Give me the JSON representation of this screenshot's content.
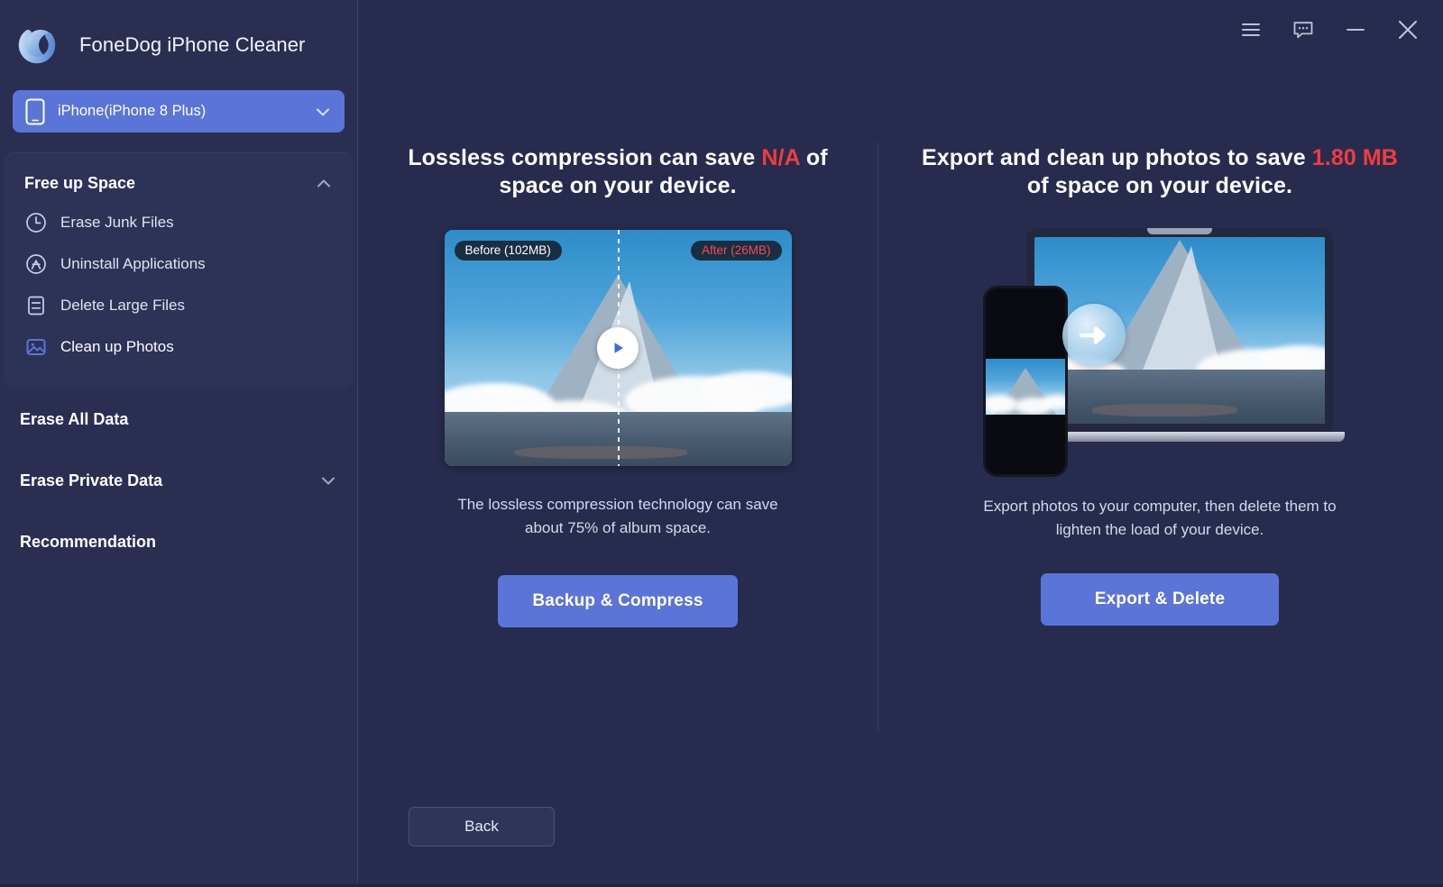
{
  "app": {
    "title": "FoneDog iPhone Cleaner",
    "logo_icon": "fonedog-c-logo-icon",
    "accent": "#5b74d8",
    "danger": "#f03c41",
    "sidebar_bg": "#2a2f52",
    "main_bg": "#272c4e"
  },
  "titlebar": {
    "menu_icon": "hamburger-menu-icon",
    "feedback_icon": "chat-bubble-icon",
    "minimize_icon": "minimize-icon",
    "close_icon": "close-icon"
  },
  "device_selector": {
    "icon": "phone-icon",
    "value": "iPhone(iPhone 8 Plus)",
    "chevron_icon": "chevron-down-icon"
  },
  "sidebar": {
    "group": {
      "label": "Free up Space",
      "chevron_icon": "chevron-up-icon",
      "expanded": true,
      "items": [
        {
          "label": "Erase Junk Files",
          "icon": "clock-icon",
          "active": false
        },
        {
          "label": "Uninstall Applications",
          "icon": "app-remove-icon",
          "active": false
        },
        {
          "label": "Delete Large Files",
          "icon": "document-icon",
          "active": false
        },
        {
          "label": "Clean up Photos",
          "icon": "photo-icon",
          "active": true
        }
      ]
    },
    "sections": [
      {
        "label": "Erase All Data",
        "chevron_icon": ""
      },
      {
        "label": "Erase Private Data",
        "chevron_icon": "chevron-down-icon"
      },
      {
        "label": "Recommendation",
        "chevron_icon": ""
      }
    ]
  },
  "left_pane": {
    "headline_part1": "Lossless compression can save ",
    "headline_highlight": "N/A",
    "headline_part2": " of space on your device.",
    "badge_before": "Before (102MB)",
    "badge_after": "After (26MB)",
    "play_icon": "play-icon",
    "caption": "The lossless compression technology can save about 75% of album space.",
    "button_label": "Backup & Compress"
  },
  "right_pane": {
    "headline_part1": "Export and clean up photos to save ",
    "headline_highlight": "1.80 MB",
    "headline_part2": " of space on your device.",
    "transfer_icon": "arrow-right-icon",
    "caption": "Export photos to your computer, then delete them to lighten the load of your device.",
    "button_label": "Export & Delete"
  },
  "footer": {
    "back_label": "Back"
  }
}
